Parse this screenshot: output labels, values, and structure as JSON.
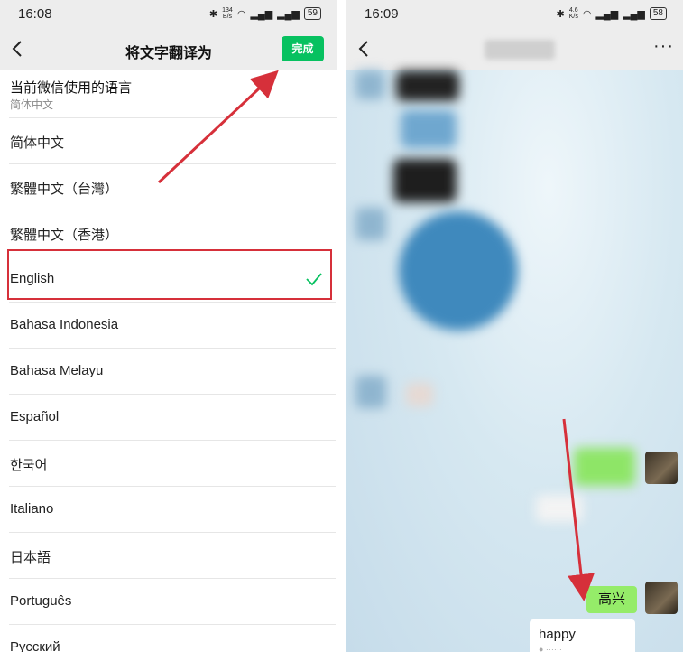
{
  "left": {
    "status": {
      "time": "16:08",
      "net_speed": "134",
      "net_unit": "B/s",
      "battery": "59"
    },
    "nav": {
      "title": "将文字翻译为",
      "done": "完成"
    },
    "current": {
      "title": "当前微信使用的语言",
      "value": "简体中文"
    },
    "languages": [
      {
        "label": "简体中文"
      },
      {
        "label": "繁體中文（台灣）"
      },
      {
        "label": "繁體中文（香港）"
      },
      {
        "label": "English",
        "selected": true
      },
      {
        "label": "Bahasa Indonesia"
      },
      {
        "label": "Bahasa Melayu"
      },
      {
        "label": "Español"
      },
      {
        "label": "한국어"
      },
      {
        "label": "Italiano"
      },
      {
        "label": "日本語"
      },
      {
        "label": "Português"
      },
      {
        "label": "Русский"
      }
    ]
  },
  "right": {
    "status": {
      "time": "16:09",
      "net_speed": "4.6",
      "net_unit": "K/s",
      "battery": "58"
    },
    "nav": {
      "more": "···"
    },
    "messages": {
      "sent": "高兴",
      "translation": "happy"
    }
  },
  "colors": {
    "accent": "#07c160",
    "annotation": "#d6303a",
    "bubble": "#95ec69"
  }
}
